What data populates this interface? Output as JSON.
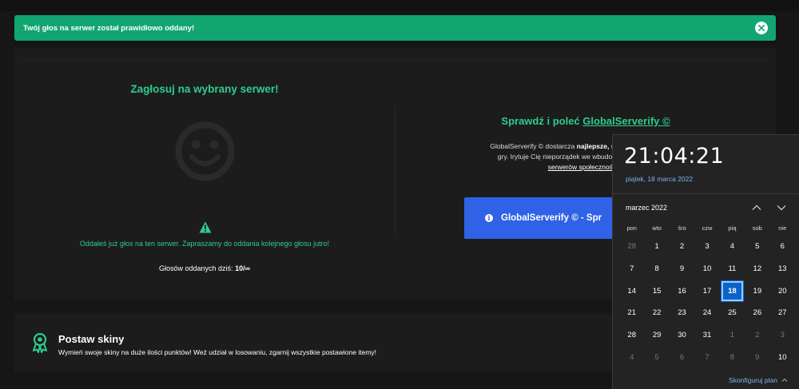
{
  "alert": {
    "message": "Twój głos na serwer został prawidłowo oddany!",
    "close_icon": "close-icon"
  },
  "vote": {
    "title": "Zagłosuj na wybrany serwer!",
    "info": "Oddałeś już głos na ten serwer. Zapraszamy do oddania kolejnego głosu jutro!",
    "count_label": "Głosów oddanych dziś:",
    "count_value": "10/∞"
  },
  "gs": {
    "title_prefix": "Sprawdź i poleć",
    "title_link": "GlobalServerify ©",
    "desc_1": "GlobalServerify © dostarcza",
    "desc_bold": "najlepsze, sprawdzone, polskie i",
    "desc_2": "gry. Irytuje Cię nieporządek we wbudowanej wyszukiwarce",
    "desc_link": "serwerów społeczności d",
    "button_label": "GlobalServerify © - Spr"
  },
  "skins": {
    "title": "Postaw skiny",
    "desc": "Wymień swoje skiny na duże ilości punktów! Weź udział w losowaniu, zgarnij wszystkie postawione itemy!"
  },
  "calendar": {
    "time": "21:04:21",
    "date_long": "piątek, 18 marca 2022",
    "month_label": "marzec 2022",
    "weekdays": [
      "pon",
      "wto",
      "śro",
      "czw",
      "pią",
      "sob",
      "nie"
    ],
    "weeks": [
      [
        "28",
        "1",
        "2",
        "3",
        "4",
        "5",
        "6"
      ],
      [
        "7",
        "8",
        "9",
        "10",
        "11",
        "12",
        "13"
      ],
      [
        "14",
        "15",
        "16",
        "17",
        "18",
        "19",
        "20"
      ],
      [
        "21",
        "22",
        "23",
        "24",
        "25",
        "26",
        "27"
      ],
      [
        "28",
        "29",
        "30",
        "31",
        "1",
        "2",
        "3"
      ],
      [
        "4",
        "5",
        "6",
        "7",
        "8",
        "9",
        "10"
      ]
    ],
    "today": "18",
    "configure_label": "Skonfiguruj plan",
    "colors": {
      "accent": "#0a64c8",
      "link": "#7fb2f0"
    }
  },
  "colors": {
    "green": "#2ecc8e",
    "alert_bg": "#12a572",
    "button_blue": "#2f62e6"
  }
}
